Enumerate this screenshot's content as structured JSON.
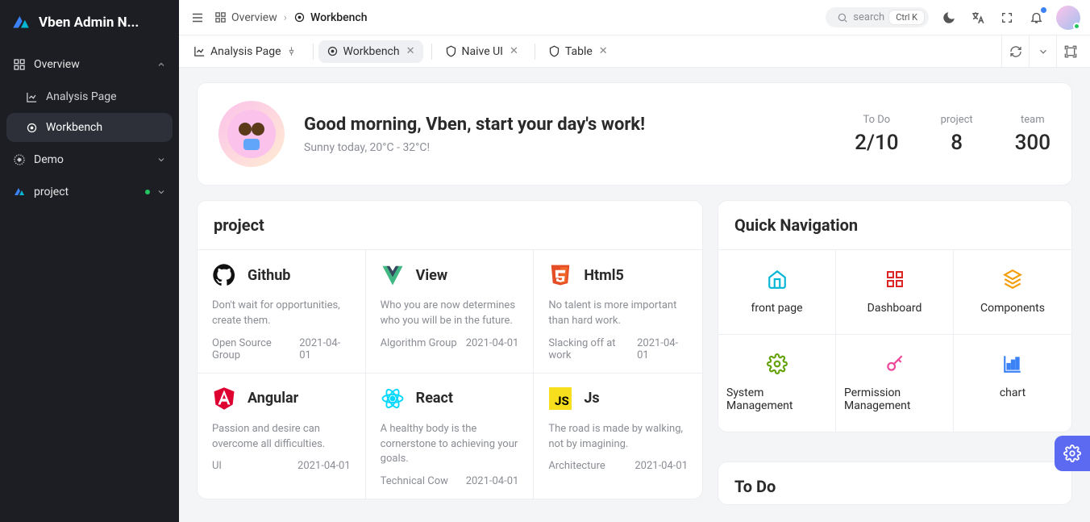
{
  "brand": {
    "name": "Vben Admin N..."
  },
  "sidebar": {
    "overview": {
      "label": "Overview"
    },
    "items": {
      "analysis": "Analysis Page",
      "workbench": "Workbench"
    },
    "demo": {
      "label": "Demo"
    },
    "project": {
      "label": "project"
    }
  },
  "breadcrumbs": {
    "root": "Overview",
    "current": "Workbench"
  },
  "search": {
    "placeholder": "search",
    "kbd": "Ctrl K"
  },
  "tabs": {
    "analysis": "Analysis Page",
    "workbench": "Workbench",
    "naive": "Naive UI",
    "table": "Table"
  },
  "welcome": {
    "title": "Good morning, Vben, start your day's work!",
    "subtitle": "Sunny today, 20°C - 32°C!",
    "stats": {
      "todo": {
        "k": "To Do",
        "v": "2/10"
      },
      "project": {
        "k": "project",
        "v": "8"
      },
      "team": {
        "k": "team",
        "v": "300"
      }
    }
  },
  "projects": {
    "title": "project",
    "items": [
      {
        "name": "Github",
        "desc": "Don't wait for opportunities, create them.",
        "group": "Open Source Group",
        "date": "2021-04-01"
      },
      {
        "name": "View",
        "desc": "Who you are now determines who you will be in the future.",
        "group": "Algorithm Group",
        "date": "2021-04-01"
      },
      {
        "name": "Html5",
        "desc": "No talent is more important than hard work.",
        "group": "Slacking off at work",
        "date": "2021-04-01"
      },
      {
        "name": "Angular",
        "desc": "Passion and desire can overcome all difficulties.",
        "group": "UI",
        "date": "2021-04-01"
      },
      {
        "name": "React",
        "desc": "A healthy body is the cornerstone to achieving your goals.",
        "group": "Technical Cow",
        "date": "2021-04-01"
      },
      {
        "name": "Js",
        "desc": "The road is made by walking, not by imagining.",
        "group": "Architecture",
        "date": "2021-04-01"
      }
    ]
  },
  "quick": {
    "title": "Quick Navigation",
    "items": [
      {
        "label": "front page"
      },
      {
        "label": "Dashboard"
      },
      {
        "label": "Components"
      },
      {
        "label": "System Management"
      },
      {
        "label": "Permission Management"
      },
      {
        "label": "chart"
      }
    ]
  },
  "todo": {
    "title": "To Do"
  }
}
